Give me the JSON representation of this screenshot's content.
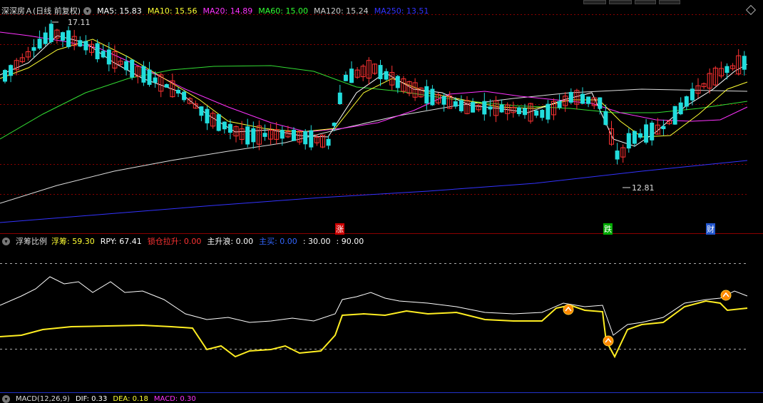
{
  "main_legend": {
    "title": "深深房Ａ(日线 前复权)",
    "ma": [
      {
        "label": "MA5: 15.83",
        "color": "#ffffff"
      },
      {
        "label": "MA10: 15.56",
        "color": "#ffff33"
      },
      {
        "label": "MA20: 14.89",
        "color": "#ff33ff"
      },
      {
        "label": "MA60: 15.00",
        "color": "#33ff33"
      },
      {
        "label": "MA120: 15.24",
        "color": "#cccccc"
      },
      {
        "label": "MA250: 13.51",
        "color": "#3333ff"
      }
    ]
  },
  "annotations": {
    "high_label": "17.11",
    "low_label": "12.81",
    "zhang": "涨",
    "die": "跌",
    "cai": "财"
  },
  "indicator_legend": {
    "title": "浮筹比例",
    "items": [
      {
        "label": "浮筹: 59.30",
        "color": "#ffff33"
      },
      {
        "label": "RPY: 67.41",
        "color": "#ffffff"
      },
      {
        "label": "锁仓拉升: 0.00",
        "color": "#ff3333"
      },
      {
        "label": "主升浪: 0.00",
        "color": "#ffffff"
      },
      {
        "label": "主买: 0.00",
        "color": "#3366ff"
      },
      {
        "label": ": 30.00",
        "color": "#ffffff"
      },
      {
        "label": ": 90.00",
        "color": "#ffffff"
      }
    ]
  },
  "macd_legend": {
    "title": "MACD(12,26,9)",
    "items": [
      {
        "label": "DIF: 0.33",
        "color": "#ffffff"
      },
      {
        "label": "DEA: 0.18",
        "color": "#ffff33"
      },
      {
        "label": "MACD: 0.30",
        "color": "#ff33ff"
      }
    ]
  }
}
